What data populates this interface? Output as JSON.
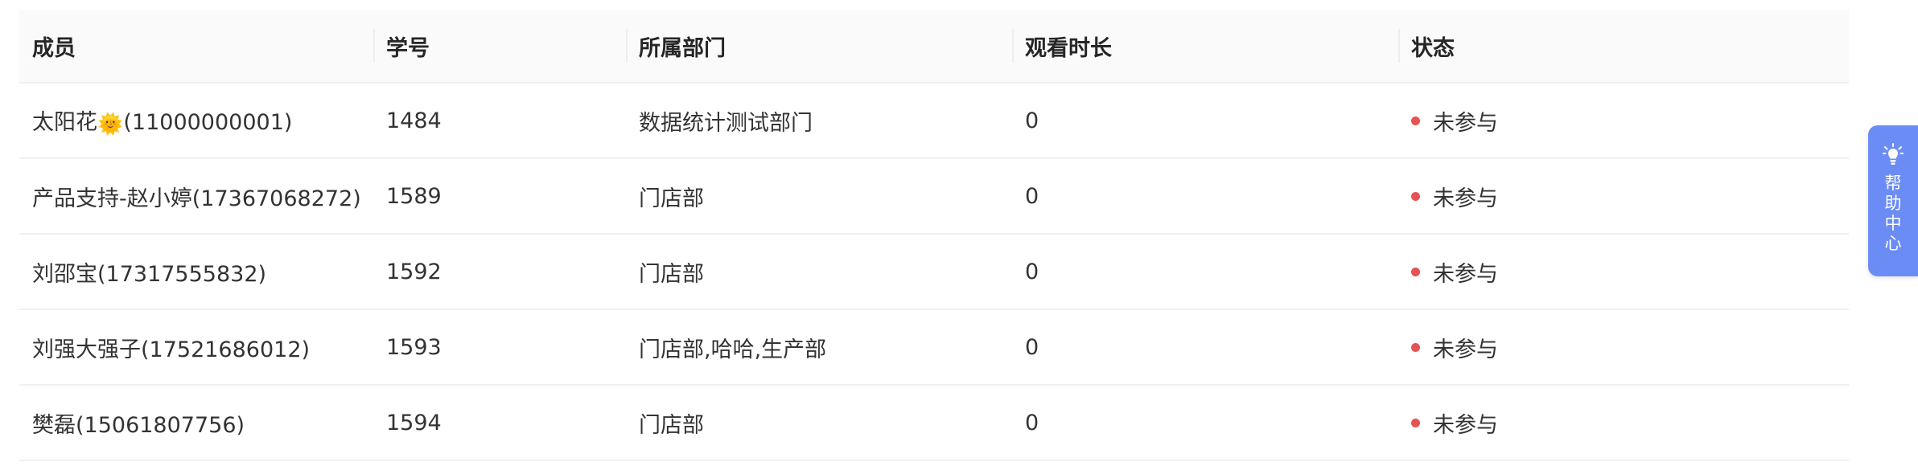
{
  "colors": {
    "header_bg": "#fafafa",
    "row_border": "#f0f0f0",
    "status_dot": "#e55353",
    "help_bg": "#6c8cf5",
    "text": "#333333"
  },
  "table": {
    "headers": [
      "成员",
      "学号",
      "所属部门",
      "观看时长",
      "状态"
    ],
    "rows": [
      {
        "member_name": "太阳花",
        "member_emoji": "🌞",
        "member_phone": "(11000000001)",
        "student_id": "1484",
        "department": "数据统计测试部门",
        "watch_time": "0",
        "status": "未参与"
      },
      {
        "member_name": "产品支持-赵小婷",
        "member_emoji": "",
        "member_phone": "(17367068272)",
        "student_id": "1589",
        "department": "门店部",
        "watch_time": "0",
        "status": "未参与"
      },
      {
        "member_name": "刘邵宝",
        "member_emoji": "",
        "member_phone": "(17317555832)",
        "student_id": "1592",
        "department": "门店部",
        "watch_time": "0",
        "status": "未参与"
      },
      {
        "member_name": "刘强大强子",
        "member_emoji": "",
        "member_phone": "(17521686012)",
        "student_id": "1593",
        "department": "门店部,哈哈,生产部",
        "watch_time": "0",
        "status": "未参与"
      },
      {
        "member_name": "樊磊",
        "member_emoji": "",
        "member_phone": "(15061807756)",
        "student_id": "1594",
        "department": "门店部",
        "watch_time": "0",
        "status": "未参与"
      }
    ]
  },
  "help_center": {
    "label": "帮助中心",
    "icon": "lightbulb-icon"
  }
}
